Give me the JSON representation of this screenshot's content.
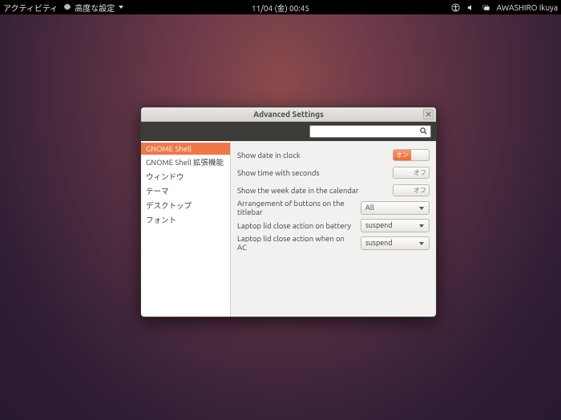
{
  "topbar": {
    "activities": "アクティビティ",
    "active_app": "高度な設定",
    "clock": "11/04 (金) 00:45",
    "user": "AWASHIRO Ikuya"
  },
  "window": {
    "title": "Advanced Settings",
    "search_placeholder": ""
  },
  "sidebar": {
    "items": [
      "GNOME Shell",
      "GNOME Shell 拡張機能",
      "ウィンドウ",
      "テーマ",
      "デスクトップ",
      "フォント"
    ],
    "selected_index": 0
  },
  "settings": {
    "rows": [
      {
        "label": "Show date in clock",
        "kind": "toggle",
        "value": "on",
        "on_text": "オン",
        "off_text": "オフ"
      },
      {
        "label": "Show time with seconds",
        "kind": "toggle",
        "value": "off",
        "on_text": "オン",
        "off_text": "オフ"
      },
      {
        "label": "Show the week date in the calendar",
        "kind": "toggle",
        "value": "off",
        "on_text": "オン",
        "off_text": "オフ"
      },
      {
        "label": "Arrangement of buttons on the titlebar",
        "kind": "combo",
        "value": "All"
      },
      {
        "label": "Laptop lid close action on battery",
        "kind": "combo",
        "value": "suspend"
      },
      {
        "label": "Laptop lid close action when on AC",
        "kind": "combo",
        "value": "suspend"
      }
    ]
  }
}
